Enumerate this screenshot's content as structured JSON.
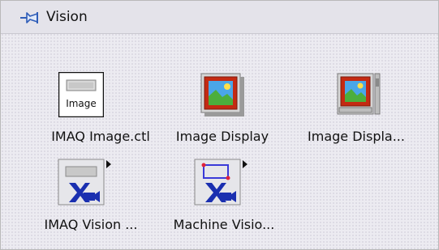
{
  "palette": {
    "title": "Vision",
    "items": [
      {
        "label": "IMAQ Image.ctl",
        "icon_text": "Image",
        "icon": "imaq-image-control-icon"
      },
      {
        "label": "Image Display",
        "icon": "image-display-icon"
      },
      {
        "label": "Image Displa...",
        "icon": "image-display-classic-icon"
      },
      {
        "label": "IMAQ Vision ...",
        "icon": "imaq-vision-controls-icon",
        "submenu": true
      },
      {
        "label": "Machine Visio...",
        "icon": "machine-vision-icon",
        "submenu": true
      }
    ]
  },
  "colors": {
    "background": "#ecebf1",
    "icon_red_frame": "#c42a12",
    "icon_blue": "#1a2fb0",
    "icon_sky": "#4aa6e8",
    "icon_grass": "#4cae3c"
  }
}
